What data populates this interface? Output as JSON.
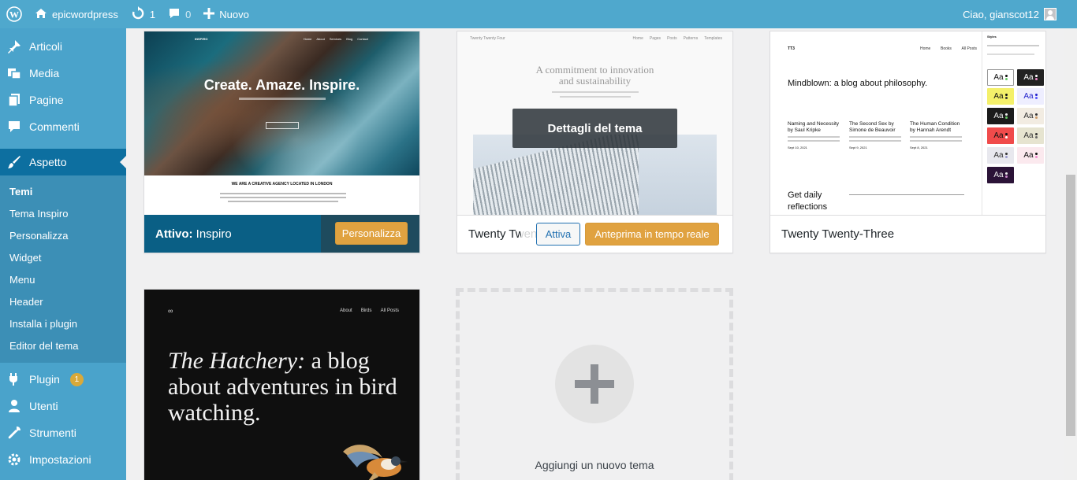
{
  "adminbar": {
    "site_name": "epicwordpress",
    "updates_count": "1",
    "comments_count": "0",
    "new_label": "Nuovo",
    "greeting": "Ciao, gianscot12"
  },
  "sidebar": {
    "items": [
      {
        "label": "Articoli",
        "icon": "pushpin-icon"
      },
      {
        "label": "Media",
        "icon": "media-icon"
      },
      {
        "label": "Pagine",
        "icon": "pages-icon"
      },
      {
        "label": "Commenti",
        "icon": "comment-icon"
      },
      {
        "label": "Aspetto",
        "icon": "brush-icon"
      }
    ],
    "submenu": [
      "Temi",
      "Tema Inspiro",
      "Personalizza",
      "Widget",
      "Menu",
      "Header",
      "Installa i plugin",
      "Editor del tema"
    ],
    "bottom_items": [
      {
        "label": "Plugin",
        "icon": "plugin-icon",
        "badge": "1"
      },
      {
        "label": "Utenti",
        "icon": "user-icon"
      },
      {
        "label": "Strumenti",
        "icon": "wrench-icon"
      },
      {
        "label": "Impostazioni",
        "icon": "settings-icon"
      }
    ]
  },
  "themes": {
    "inspiro": {
      "screenshot_title": "Create. Amaze. Inspire.",
      "screenshot_logo": "INSPIRO",
      "screenshot_nav": [
        "Home",
        "About",
        "Services",
        "Blog",
        "Contact"
      ],
      "screenshot_subheading": "WE ARE A CREATIVE AGENCY LOCATED IN LONDON",
      "active_prefix": "Attivo:",
      "active_name": "Inspiro",
      "customize_label": "Personalizza"
    },
    "tt4": {
      "screenshot_brand": "Twenty Twenty Four",
      "screenshot_nav": [
        "Home",
        "Pages",
        "Posts",
        "Patterns",
        "Templates"
      ],
      "screenshot_heading": "A commitment to innovation and sustainability",
      "details_label": "Dettagli del tema",
      "name": "Twenty Twenty-Four",
      "activate_label": "Attiva",
      "preview_label": "Anteprima in tempo reale"
    },
    "tt3": {
      "screenshot_brand": "TT3",
      "screenshot_nav": [
        "Home",
        "Books",
        "All Posts"
      ],
      "screenshot_heading": "Mindblown: a blog about philosophy.",
      "posts": [
        {
          "title": "Naming and Necessity by Saul Kripke",
          "date": "Sept 10, 2021"
        },
        {
          "title": "The Second Sex by Simone de Beauvoir",
          "date": "Sept 9, 2021"
        },
        {
          "title": "The Human Condition by Hannah Arendt",
          "date": "Sept 8, 2021"
        }
      ],
      "daily_text": "Get daily reflections",
      "styles_title": "Styles",
      "swatch_label": "Aa",
      "name": "Twenty Twenty-Three"
    },
    "hatchery": {
      "screenshot_logo": "∞",
      "screenshot_nav": [
        "About",
        "Birds",
        "All Posts"
      ],
      "heading_italic": "The Hatchery:",
      "heading_rest": " a blog about adventures in bird watching."
    },
    "add_new_label": "Aggiungi un nuovo tema"
  }
}
